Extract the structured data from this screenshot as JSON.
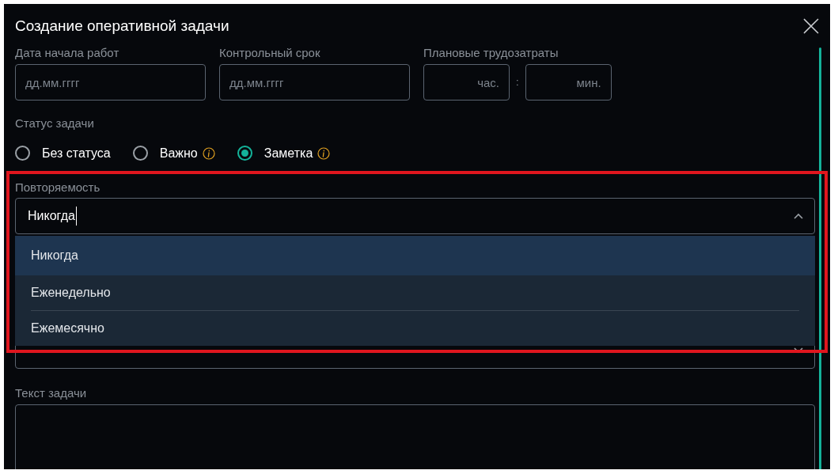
{
  "dialog": {
    "title": "Создание оперативной задачи"
  },
  "dates": [
    {
      "label": "Дата начала работ",
      "placeholder": "дд.мм.гггг"
    },
    {
      "label": "Контрольный срок",
      "placeholder": "дд.мм.гггг"
    }
  ],
  "effort": {
    "label": "Плановые трудозатраты",
    "hours_placeholder": "час.",
    "separator": ":",
    "minutes_placeholder": "мин."
  },
  "status": {
    "label": "Статус задачи",
    "options": [
      {
        "label": "Без статуса",
        "selected": false,
        "info": false
      },
      {
        "label": "Важно",
        "selected": false,
        "info": true
      },
      {
        "label": "Заметка",
        "selected": true,
        "info": true
      }
    ]
  },
  "repeat": {
    "label": "Повторяемость",
    "value": "Никогда",
    "expanded": true,
    "options": [
      {
        "label": "Никогда",
        "selected": true
      },
      {
        "label": "Еженедельно",
        "selected": false
      },
      {
        "label": "Ежемесячно",
        "selected": false
      }
    ]
  },
  "task_text": {
    "label": "Текст задачи"
  }
}
